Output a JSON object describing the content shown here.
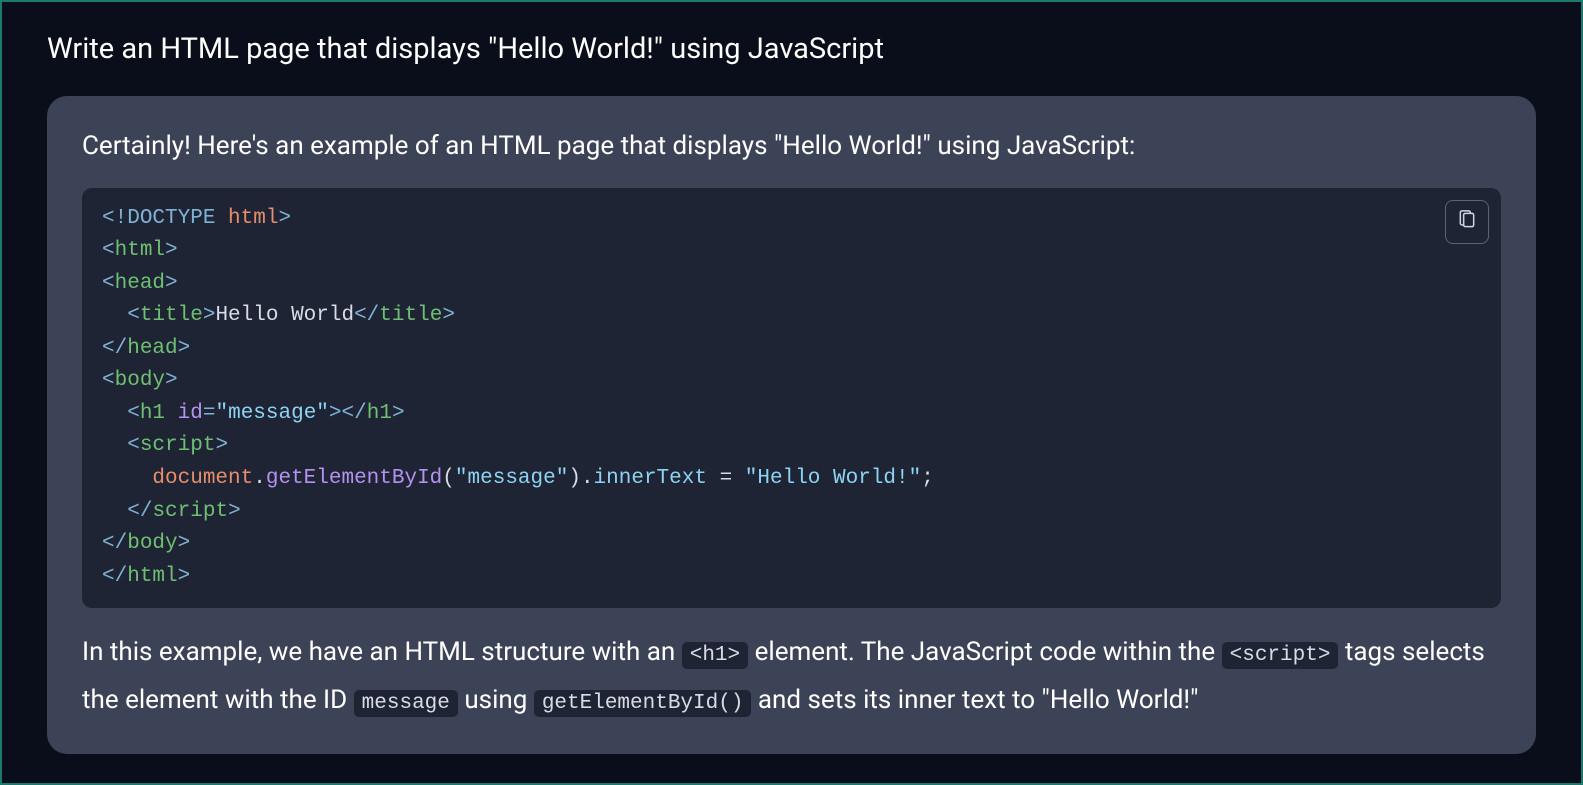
{
  "prompt": "Write an HTML page that displays \"Hello World!\" using JavaScript",
  "response": {
    "intro": "Certainly! Here's an example of an HTML page that displays \"Hello World!\" using JavaScript:",
    "explanation_parts": {
      "p1": "In this example, we have an HTML structure with an ",
      "ic1": "<h1>",
      "p2": " element. The JavaScript code within the ",
      "ic2": "<script>",
      "p3": " tags selects the element with the ID ",
      "ic3": "message",
      "p4": " using ",
      "ic4": "getElementById()",
      "p5": " and sets its inner text to \"Hello World!\""
    }
  },
  "code": {
    "l1_doctype_open": "<!",
    "l1_doctype_kw": "DOCTYPE",
    "l1_doctype_name": " html",
    "l1_doctype_close": ">",
    "l2_open": "<",
    "l2_tag": "html",
    "l2_close": ">",
    "l3_open": "<",
    "l3_tag": "head",
    "l3_close": ">",
    "l4_indent": "  ",
    "l4_open": "<",
    "l4_tag": "title",
    "l4_close1": ">",
    "l4_text": "Hello World",
    "l4_open2": "</",
    "l4_tag2": "title",
    "l4_close2": ">",
    "l5_open": "</",
    "l5_tag": "head",
    "l5_close": ">",
    "l6_open": "<",
    "l6_tag": "body",
    "l6_close": ">",
    "l7_indent": "  ",
    "l7_open": "<",
    "l7_tag": "h1",
    "l7_sp": " ",
    "l7_attr": "id",
    "l7_eq": "=",
    "l7_val": "\"message\"",
    "l7_close1": ">",
    "l7_open2": "</",
    "l7_tag2": "h1",
    "l7_close2": ">",
    "l8_indent": "  ",
    "l8_open": "<",
    "l8_tag": "script",
    "l8_close": ">",
    "l9_indent": "    ",
    "l9_obj": "document",
    "l9_dot1": ".",
    "l9_method": "getElementById",
    "l9_paren1": "(",
    "l9_arg": "\"message\"",
    "l9_paren2": ")",
    "l9_dot2": ".",
    "l9_prop": "innerText",
    "l9_sp": " ",
    "l9_eq": "=",
    "l9_sp2": " ",
    "l9_str": "\"Hello World!\"",
    "l9_semi": ";",
    "l10_indent": "  ",
    "l10_open": "</",
    "l10_tag": "script",
    "l10_close": ">",
    "l11_open": "</",
    "l11_tag": "body",
    "l11_close": ">",
    "l12_open": "</",
    "l12_tag": "html",
    "l12_close": ">"
  }
}
